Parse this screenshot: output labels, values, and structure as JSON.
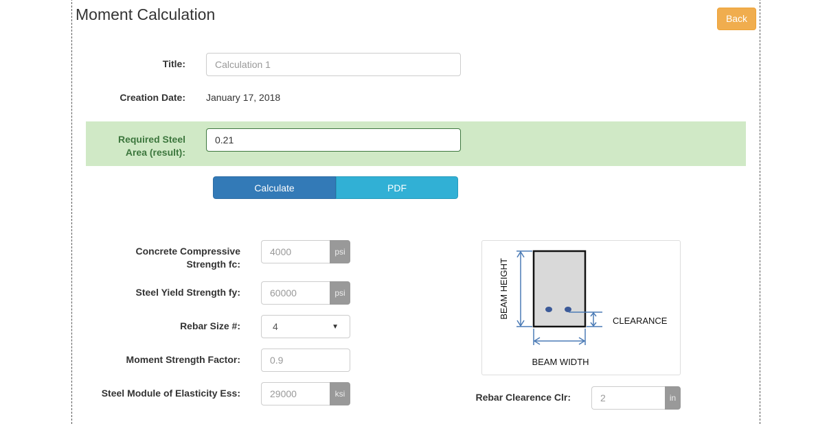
{
  "header": {
    "title": "Moment Calculation",
    "back_label": "Back"
  },
  "form": {
    "title_label": "Title:",
    "title_placeholder": "Calculation 1",
    "creation_label": "Creation Date:",
    "creation_value": "January 17, 2018",
    "result_label_line1": "Required Steel",
    "result_label_line2": "Area (result):",
    "result_value": "0.21"
  },
  "actions": {
    "calculate_label": "Calculate",
    "pdf_label": "PDF"
  },
  "params": {
    "fc_label_line1": "Concrete Compressive",
    "fc_label_line2": "Strength fc:",
    "fc_placeholder": "4000",
    "fc_unit": "psi",
    "fy_label": "Steel Yield Strength fy:",
    "fy_placeholder": "60000",
    "fy_unit": "psi",
    "rebar_label": "Rebar Size #:",
    "rebar_value": "4",
    "moment_label": "Moment Strength Factor:",
    "moment_placeholder": "0.9",
    "ess_label": "Steel Module of Elasticity Ess:",
    "ess_placeholder": "29000",
    "ess_unit": "ksi",
    "clr_label": "Rebar Clearence Clr:",
    "clr_placeholder": "2",
    "clr_unit": "in"
  },
  "diagram": {
    "height_label": "BEAM HEIGHT",
    "width_label": "BEAM WIDTH",
    "clearance_label": "CLEARANCE"
  },
  "colors": {
    "back_button": "#f0ad4e",
    "calculate_button": "#337ab7",
    "pdf_button": "#31b0d5",
    "result_background": "#d0e9c6",
    "result_text": "#3c763d",
    "dimension_lines": "#4a7ab5",
    "rebar_dots": "#3b5998"
  }
}
